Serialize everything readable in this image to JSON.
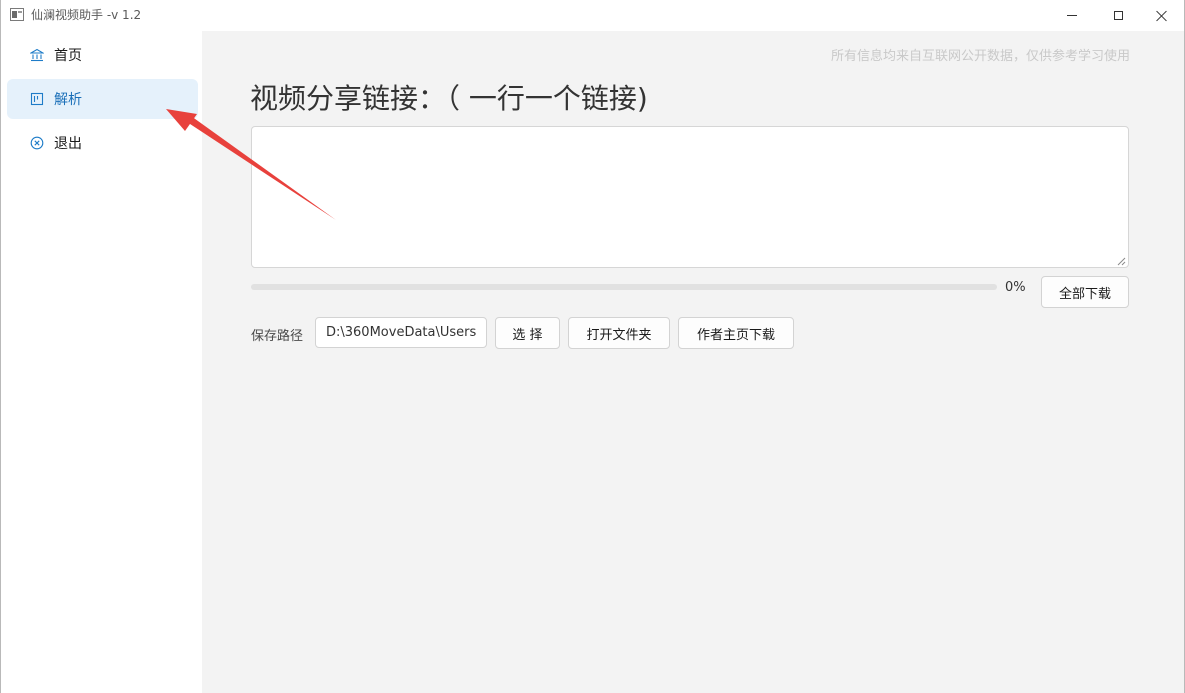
{
  "window": {
    "title": "仙澜视频助手 -v 1.2"
  },
  "sidebar": {
    "items": [
      {
        "label": "首页",
        "icon": "bank-icon"
      },
      {
        "label": "解析",
        "icon": "panel-icon",
        "active": true
      },
      {
        "label": "退出",
        "icon": "close-circle-icon"
      }
    ]
  },
  "main": {
    "disclaimer": "所有信息均来自互联网公开数据，仅供参考学习使用",
    "heading": "视频分享链接：（ 一行一个链接)",
    "links_value": "",
    "progress": {
      "percent": 0,
      "label": "0%"
    },
    "download_all_label": "全部下载",
    "save_path": {
      "label": "保存路径",
      "value": "D:\\360MoveData\\Users\\"
    },
    "choose_label": "选 择",
    "open_folder_label": "打开文件夹",
    "author_download_label": "作者主页下载"
  },
  "colors": {
    "accent": "#1e7cc8",
    "active_bg": "#e5f1fb",
    "arrow": "#e8413c"
  }
}
